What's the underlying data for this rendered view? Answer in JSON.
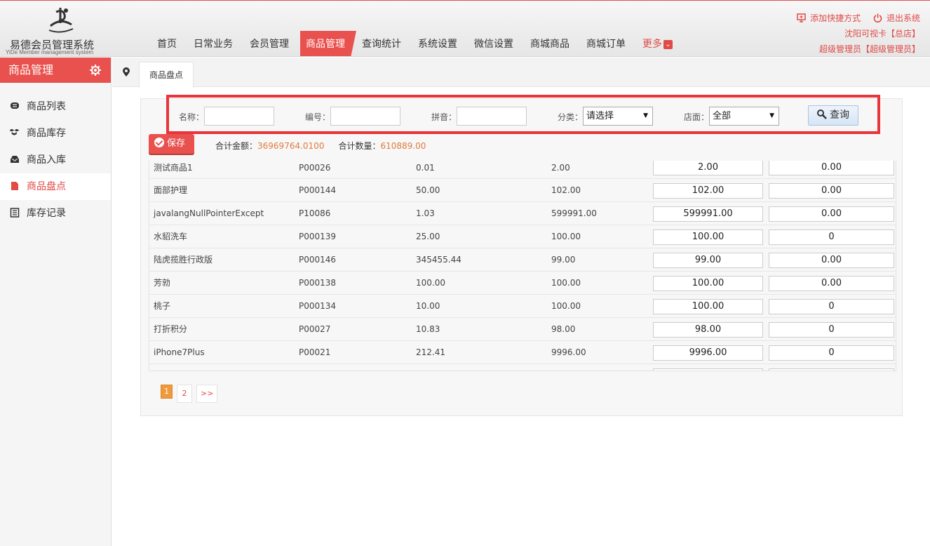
{
  "app": {
    "title": "易德会员管理系统",
    "subtitle": "YiDe Member management system"
  },
  "nav": [
    {
      "label": "首页"
    },
    {
      "label": "日常业务"
    },
    {
      "label": "会员管理"
    },
    {
      "label": "商品管理"
    },
    {
      "label": "查询统计"
    },
    {
      "label": "系统设置"
    },
    {
      "label": "微信设置"
    },
    {
      "label": "商城商品"
    },
    {
      "label": "商城订单"
    },
    {
      "label": "更多"
    }
  ],
  "nav_active_index": 3,
  "header_right": {
    "shortcut": "添加快捷方式",
    "logout": "退出系统",
    "store": "沈阳可视卡【总店】",
    "user": "超级管理员【超级管理员】"
  },
  "sidebar": {
    "title": "商品管理",
    "items": [
      {
        "label": "商品列表",
        "icon": "list-bubble-icon"
      },
      {
        "label": "商品库存",
        "icon": "boxes-icon"
      },
      {
        "label": "商品入库",
        "icon": "inbox-icon"
      },
      {
        "label": "商品盘点",
        "icon": "document-icon",
        "active": true
      },
      {
        "label": "库存记录",
        "icon": "ledger-icon"
      }
    ]
  },
  "tab": {
    "label": "商品盘点"
  },
  "search": {
    "name_label": "名称：",
    "code_label": "编号：",
    "pinyin_label": "拼音：",
    "category_label": "分类：",
    "category_value": "请选择",
    "store_label": "店面：",
    "store_value": "全部",
    "query_label": "查询"
  },
  "toolbar": {
    "save_label": "保存",
    "total_amount_label": "合计金额：",
    "total_amount": "36969764.0100",
    "total_qty_label": "合计数量：",
    "total_qty": "610889.00"
  },
  "rows": [
    {
      "name": "测试商品1",
      "code": "P00026",
      "price": "0.01",
      "stock": "2.00",
      "actual": "2.00",
      "diff": "0.00"
    },
    {
      "name": "面部护理",
      "code": "P000144",
      "price": "50.00",
      "stock": "102.00",
      "actual": "102.00",
      "diff": "0.00"
    },
    {
      "name": "javalangNullPointerExcept",
      "code": "P10086",
      "price": "1.03",
      "stock": "599991.00",
      "actual": "599991.00",
      "diff": "0.00"
    },
    {
      "name": "水貂洗车",
      "code": "P000139",
      "price": "25.00",
      "stock": "100.00",
      "actual": "100.00",
      "diff": "0"
    },
    {
      "name": "陆虎揽胜行政版",
      "code": "P000146",
      "price": "345455.44",
      "stock": "99.00",
      "actual": "99.00",
      "diff": "0.00"
    },
    {
      "name": "芳勍",
      "code": "P000138",
      "price": "100.00",
      "stock": "100.00",
      "actual": "100.00",
      "diff": "0.00"
    },
    {
      "name": "桃子",
      "code": "P000134",
      "price": "10.00",
      "stock": "100.00",
      "actual": "100.00",
      "diff": "0"
    },
    {
      "name": "打折积分",
      "code": "P00027",
      "price": "10.83",
      "stock": "98.00",
      "actual": "98.00",
      "diff": "0"
    },
    {
      "name": "iPhone7Plus",
      "code": "P00021",
      "price": "212.41",
      "stock": "9996.00",
      "actual": "9996.00",
      "diff": "0"
    }
  ],
  "pagination": {
    "pages": [
      "1",
      "2"
    ],
    "next": ">>",
    "current": "1"
  },
  "colors": {
    "accent": "#e8514e",
    "highlight": "#e8343a",
    "value": "#e07b3c"
  }
}
